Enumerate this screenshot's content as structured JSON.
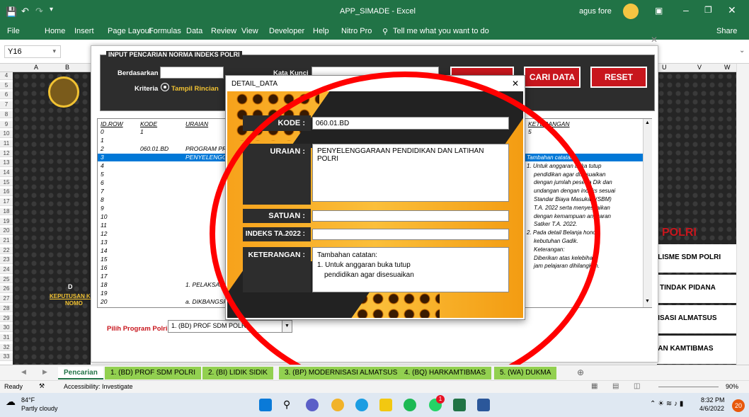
{
  "window": {
    "title": "APP_SIMADE  -  Excel",
    "user": "agus fore",
    "share": "Share"
  },
  "ribbon": {
    "tabs": [
      "File",
      "Home",
      "Insert",
      "Page Layout",
      "Formulas",
      "Data",
      "Review",
      "View",
      "Developer",
      "Help",
      "Nitro Pro"
    ],
    "tell_me": "Tell me what you want to do"
  },
  "formula": {
    "name_box": "Y16"
  },
  "columns_right": [
    "U",
    "V",
    "W"
  ],
  "columns_left": [
    "A",
    "B"
  ],
  "form": {
    "header": "INPUT PENCARIAN NORMA INDEKS POLRI",
    "berdasarkan_label": "Berdasarkan",
    "kata_kunci_label": "Kata Kunci",
    "kriteria_label": "Kriteria",
    "tampil_rincian": "Tampil Rincian",
    "cari_button": "CARI DATA",
    "reset_button": "RESET",
    "list_headers": {
      "id": "ID.ROW",
      "kode": "KODE",
      "uraian": "URAIAN",
      "keterangan": "KETERANGAN"
    },
    "list_rows": [
      {
        "id": "0",
        "kode": "1",
        "uraian": ""
      },
      {
        "id": "1",
        "kode": "",
        "uraian": ""
      },
      {
        "id": "2",
        "kode": "060.01.BD",
        "uraian": "PROGRAM PR"
      },
      {
        "id": "3",
        "kode": "",
        "uraian": "PENYELENGG"
      },
      {
        "id": "4",
        "kode": "",
        "uraian": ""
      },
      {
        "id": "5",
        "kode": "",
        "uraian": ""
      },
      {
        "id": "6",
        "kode": "",
        "uraian": ""
      },
      {
        "id": "7",
        "kode": "",
        "uraian": ""
      },
      {
        "id": "8",
        "kode": "",
        "uraian": ""
      },
      {
        "id": "9",
        "kode": "",
        "uraian": ""
      },
      {
        "id": "10",
        "kode": "",
        "uraian": ""
      },
      {
        "id": "11",
        "kode": "",
        "uraian": ""
      },
      {
        "id": "12",
        "kode": "",
        "uraian": ""
      },
      {
        "id": "13",
        "kode": "",
        "uraian": ""
      },
      {
        "id": "14",
        "kode": "",
        "uraian": ""
      },
      {
        "id": "15",
        "kode": "",
        "uraian": ""
      },
      {
        "id": "16",
        "kode": "",
        "uraian": ""
      },
      {
        "id": "17",
        "kode": "",
        "uraian": ""
      },
      {
        "id": "18",
        "kode": "",
        "uraian": "1. PELAKSANA"
      },
      {
        "id": "19",
        "kode": "",
        "uraian": ""
      },
      {
        "id": "20",
        "kode": "",
        "uraian": "a. DIKBANGSP"
      }
    ],
    "keterangan_first": "5",
    "keterangan_lines": [
      "Tambahan catatan:",
      "1. Untuk  anggaran  buka  tutup",
      "pendidikan agar disesuaikan",
      "dengan jumlah peserta Dik dan",
      "undangan dengan indeks sesuai",
      "Standar Biaya Masukan (SBM)",
      "T.A. 2022  serta  menyesuaikan",
      "dengan kemampuan anggaran",
      "Satker T.A. 2022.",
      "2. Pada  detail  Belanja  honor",
      "kebutuhan Gadik.",
      "Keterangan:",
      "Diberikan  atas  kelebihan",
      "jam pelajaran dihilangkan."
    ],
    "pilih_label": "Pilih Program Polri",
    "pilih_value": "1. (BD) PROF SDM POLRI"
  },
  "left_panel": {
    "link1": "KEPUTUSAN KE",
    "link2": "NOMO",
    "d": "D"
  },
  "right_panel": {
    "polri": "POLRI",
    "items": [
      "ALISME SDM POLRI",
      "K TINDAK PIDANA",
      "NISASI ALMATSUS",
      "AAN KAMTIBMAS"
    ]
  },
  "dialog": {
    "title": "DETAIL_DATA",
    "kode_label": "KODE",
    "kode_value": "060.01.BD",
    "uraian_label": "URAIAN",
    "uraian_value": "PENYELENGGARAAN PENDIDIKAN DAN LATIHAN POLRI",
    "satuan_label": "SATUAN",
    "satuan_value": "",
    "indeks_label": "INDEKS TA.2022",
    "indeks_value": "",
    "keterangan_label": "KETERANGAN",
    "keterangan_lines": [
      "Tambahan catatan:",
      "1. Untuk  anggaran  buka  tutup",
      "pendidikan agar disesuaikan"
    ]
  },
  "sheet_tabs": [
    "Pencarian",
    "1. (BD) PROF SDM POLRI",
    "2. (BI) LIDIK SIDIK",
    "3. (BP) MODERNISASI ALMATSUS",
    "4. (BQ) HARKAMTIBMAS",
    "5. (WA) DUKMA"
  ],
  "status": {
    "ready": "Ready",
    "accessibility": "Accessibility: Investigate",
    "zoom": "90%"
  },
  "taskbar": {
    "temp": "84°F",
    "weather": "Partly cloudy",
    "time": "8:32 PM",
    "date": "4/6/2022",
    "badge": "20",
    "notif": "1"
  },
  "colors": {
    "excel_green": "#217346",
    "red_button": "#c8161d",
    "orange": "#f7a21b",
    "annotation_red": "#ff0000"
  }
}
